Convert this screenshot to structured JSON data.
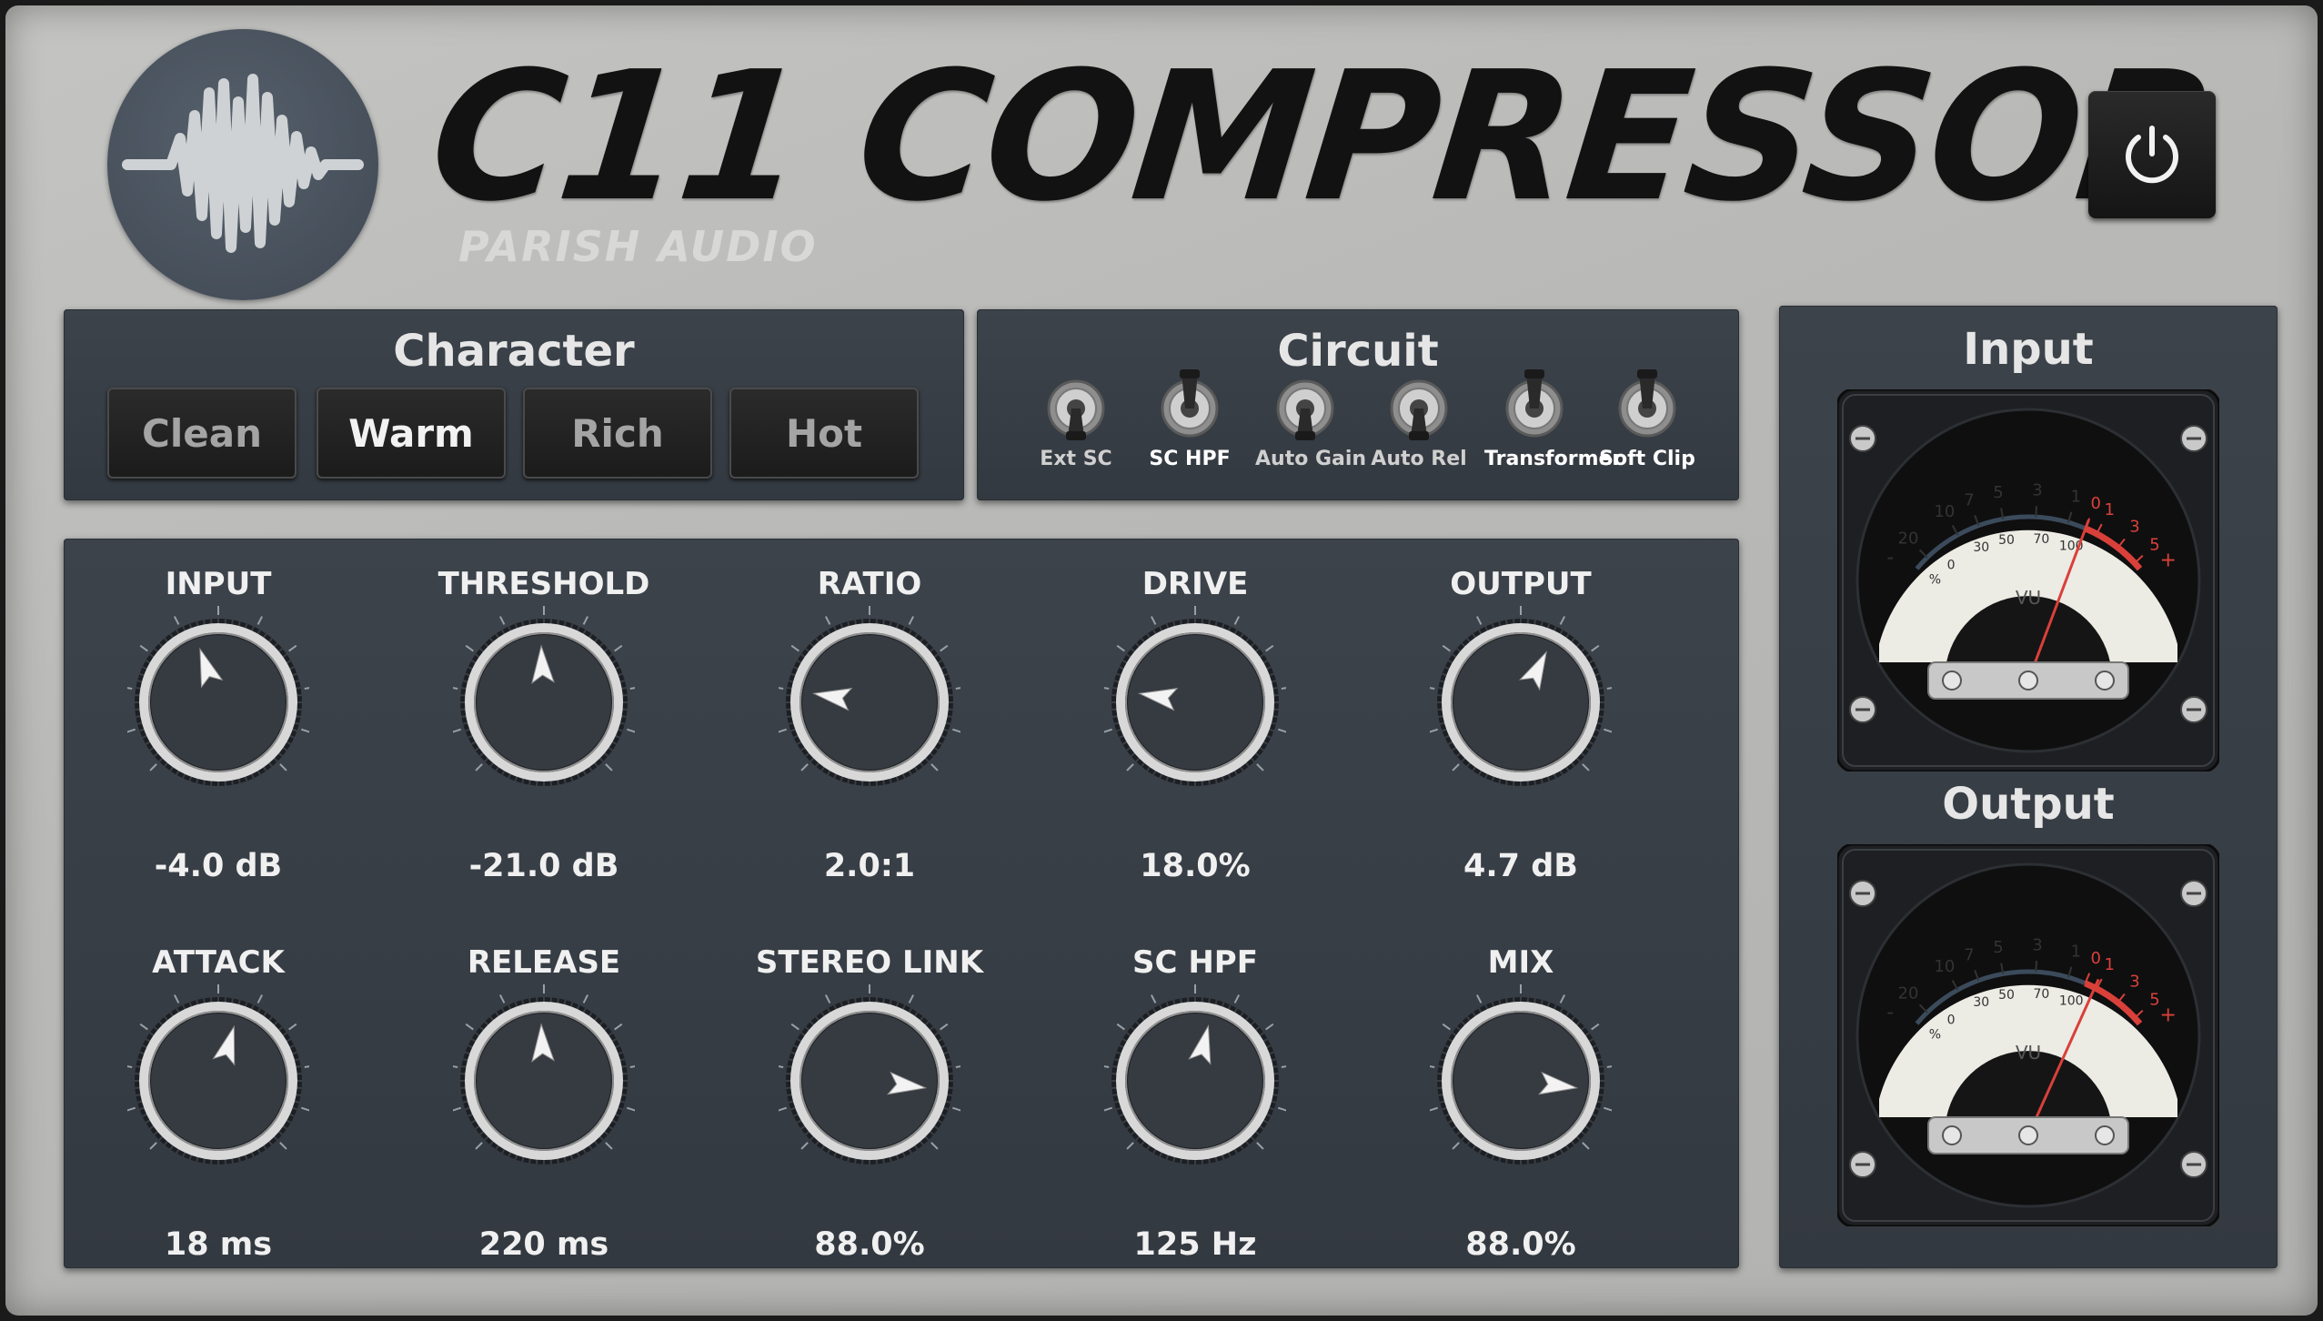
{
  "header": {
    "title": "C11 COMPRESSOR",
    "brand": "PARISH AUDIO",
    "power_icon": "power-icon",
    "logo_icon": "waveform-icon"
  },
  "character": {
    "title": "Character",
    "modes": [
      {
        "label": "Clean",
        "active": false
      },
      {
        "label": "Warm",
        "active": true
      },
      {
        "label": "Rich",
        "active": false
      },
      {
        "label": "Hot",
        "active": false
      }
    ]
  },
  "circuit": {
    "title": "Circuit",
    "switches": [
      {
        "label": "Ext SC",
        "on": false
      },
      {
        "label": "SC HPF",
        "on": true
      },
      {
        "label": "Auto Gain",
        "on": false
      },
      {
        "label": "Auto Rel",
        "on": false
      },
      {
        "label": "Transformer",
        "on": true
      },
      {
        "label": "Soft Clip",
        "on": true
      }
    ]
  },
  "knobs": [
    {
      "label": "INPUT",
      "value": "-4.0 dB",
      "position": 0.43
    },
    {
      "label": "THRESHOLD",
      "value": "-21.0 dB",
      "position": 0.49
    },
    {
      "label": "RATIO",
      "value": "2.0:1",
      "position": 0.2
    },
    {
      "label": "DRIVE",
      "value": "18.0%",
      "position": 0.2
    },
    {
      "label": "OUTPUT",
      "value": "4.7 dB",
      "position": 0.6
    },
    {
      "label": "ATTACK",
      "value": "18 ms",
      "position": 0.56
    },
    {
      "label": "RELEASE",
      "value": "220 ms",
      "position": 0.49
    },
    {
      "label": "STEREO LINK",
      "value": "88.0%",
      "position": 0.86
    },
    {
      "label": "SC HPF",
      "value": "125 Hz",
      "position": 0.55
    },
    {
      "label": "MIX",
      "value": "88.0%",
      "position": 0.86
    }
  ],
  "meters": [
    {
      "title": "Input",
      "unit": "VU",
      "needle": 0.73
    },
    {
      "title": "Output",
      "unit": "VU",
      "needle": 0.77
    }
  ],
  "vu_scale": {
    "top": [
      "20",
      "10",
      "7",
      "5",
      "3",
      "1",
      "0",
      "1",
      "3",
      "5"
    ],
    "bottom": [
      "0",
      "30",
      "50",
      "70",
      "100"
    ],
    "minus": "-",
    "plus": "+",
    "percent": "%"
  },
  "colors": {
    "panel": "#373d44",
    "chrome": "#d8d8d8",
    "meter_face": "#ecebe4",
    "meter_red": "#d9403a",
    "accent_dark": "#121212"
  }
}
